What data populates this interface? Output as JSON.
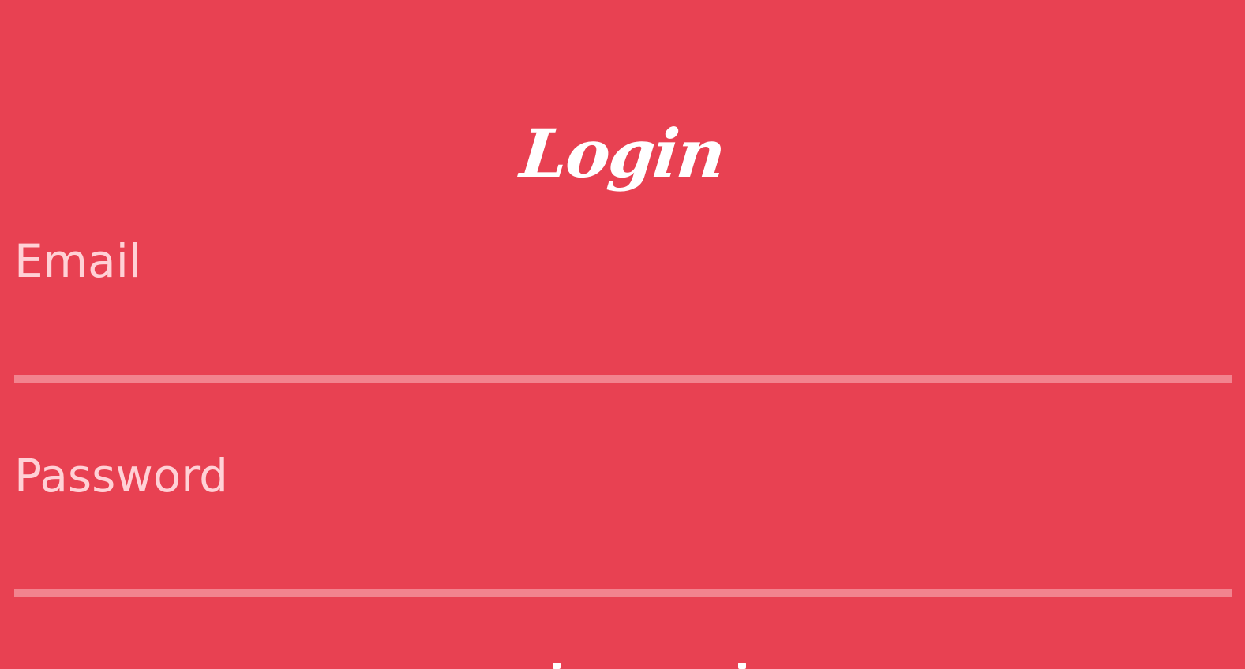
{
  "form": {
    "title": "Login",
    "email": {
      "label": "Email",
      "value": "",
      "placeholder": ""
    },
    "password": {
      "label": "Password",
      "value": "",
      "placeholder": ""
    }
  },
  "colors": {
    "background": "#e84152",
    "label": "#ffd1d6",
    "underline": "#f2838e",
    "title": "#ffffff"
  }
}
